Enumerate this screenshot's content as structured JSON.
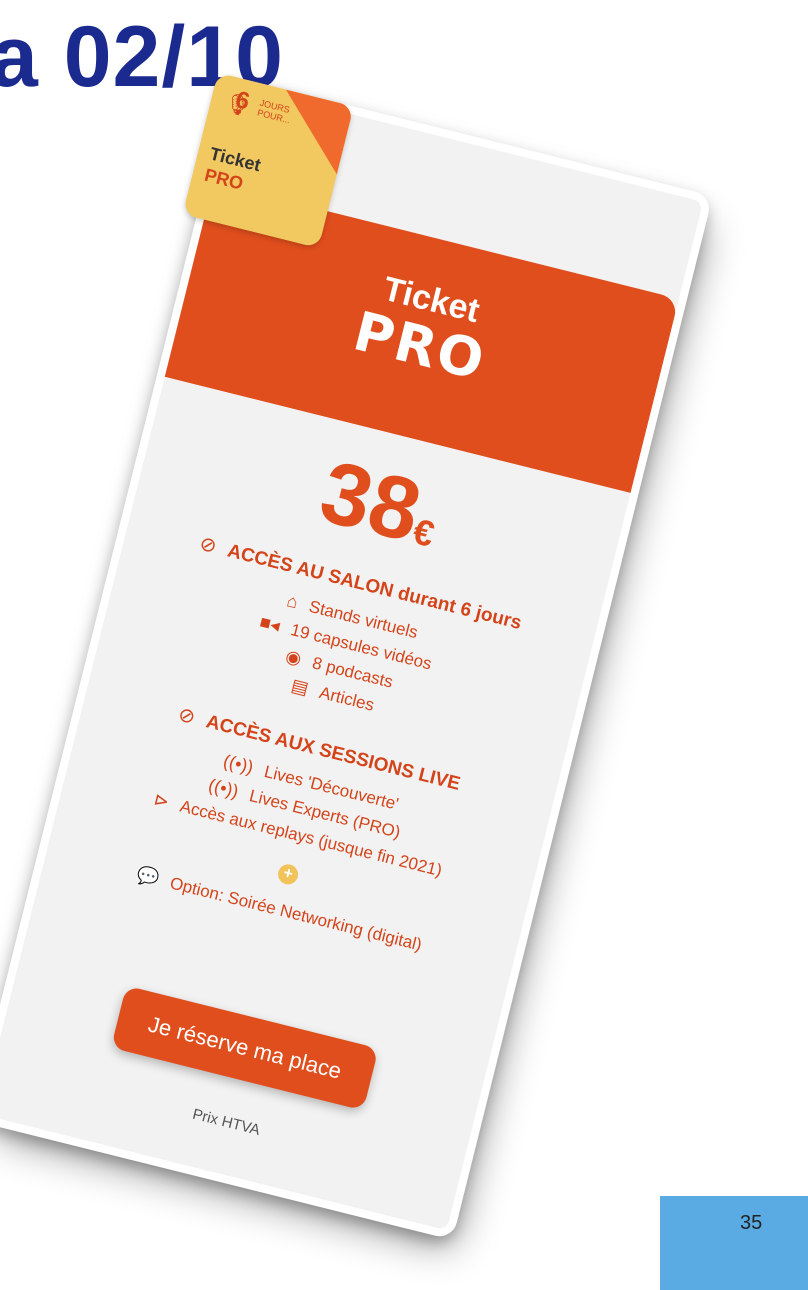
{
  "slide": {
    "title_fragment": "a 02/10",
    "page_number": "35"
  },
  "badge": {
    "days": "6",
    "small_text": "JOURS POUR...",
    "ticket": "Ticket",
    "pro": "PRO"
  },
  "card": {
    "header_ticket": "Ticket",
    "header_pro": "PRO",
    "price": "38",
    "currency": "€",
    "salon": {
      "head_bold": "ACCÈS AU SALON",
      "head_rest": " durant 6 jours",
      "items": [
        {
          "icon": "store-icon",
          "label": "Stands virtuels"
        },
        {
          "icon": "video-camera-icon",
          "label": "19 capsules vidéos"
        },
        {
          "icon": "podcast-icon",
          "label": "8 podcasts"
        },
        {
          "icon": "newspaper-icon",
          "label": "Articles"
        }
      ]
    },
    "sessions": {
      "head": "ACCÈS AUX SESSIONS LIVE",
      "items": [
        {
          "icon": "broadcast-icon",
          "label": "Lives 'Découverte'"
        },
        {
          "icon": "broadcast-icon",
          "label": "Lives Experts (PRO)"
        },
        {
          "icon": "play-circle-icon",
          "label": "Accès aux replays (jusque fin 2021)"
        }
      ]
    },
    "plus_symbol": "+",
    "option": "Option: Soirée Networking (digital)",
    "cta_label": "Je réserve ma place",
    "price_note": "Prix HTVA"
  }
}
